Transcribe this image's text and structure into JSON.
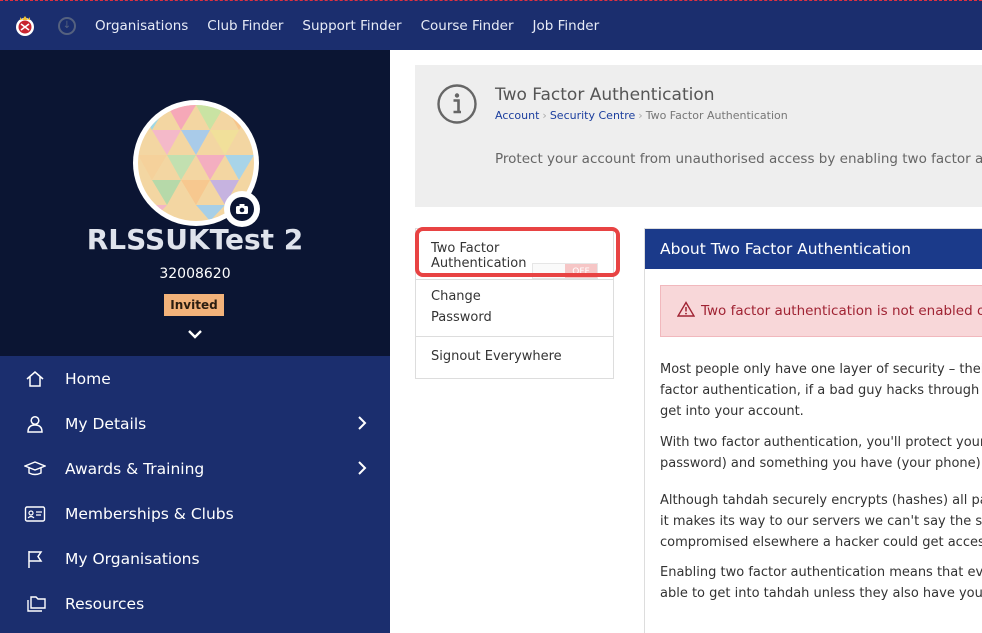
{
  "nav": {
    "links": [
      "Organisations",
      "Club Finder",
      "Support Finder",
      "Course Finder",
      "Job Finder"
    ]
  },
  "profile": {
    "name": "RLSSUKTest 2",
    "member_number": "32008620",
    "status_badge": "Invited"
  },
  "sidebar": {
    "items": [
      {
        "label": "Home",
        "icon": "home-icon",
        "has_arrow": false
      },
      {
        "label": "My Details",
        "icon": "user-icon",
        "has_arrow": true
      },
      {
        "label": "Awards & Training",
        "icon": "graduation-cap-icon",
        "has_arrow": true
      },
      {
        "label": "Memberships & Clubs",
        "icon": "id-card-icon",
        "has_arrow": false
      },
      {
        "label": "My Organisations",
        "icon": "flag-icon",
        "has_arrow": false
      },
      {
        "label": "Resources",
        "icon": "folders-icon",
        "has_arrow": false
      }
    ]
  },
  "header": {
    "title": "Two Factor Authentication",
    "breadcrumb": [
      "Account",
      "Security Centre",
      "Two Factor Authentication"
    ],
    "description": "Protect your account from unauthorised access by enabling two factor authent"
  },
  "tabs": {
    "two_factor": "Two Factor Authentication",
    "toggle_state": "OFF",
    "change_password_line1": "Change",
    "change_password_line2": "Password",
    "signout": "Signout Everywhere"
  },
  "about": {
    "title": "About Two Factor Authentication",
    "alert": "Two factor authentication is not enabled on yo",
    "paragraphs": [
      [
        "Most people only have one layer of security – their pa",
        "factor authentication, if a bad guy hacks through yo",
        "get into your account."
      ],
      [
        "With two factor authentication, you'll protect your a",
        "password) and something you have (your phone)."
      ],
      [
        "Although tahdah securely encrypts (hashes) all pass",
        "it makes its way to our servers we can't say the same",
        "compromised elsewhere a hacker could get access to"
      ],
      [
        "Enabling two factor authentication means that ever",
        "able to get into tahdah unless they also have your ph"
      ]
    ]
  },
  "colors": {
    "nav_bg": "#1b2e6e",
    "sidebar_dark": "#0b1533",
    "accent_blue": "#1b3a8a",
    "highlight_red": "#e84343",
    "badge": "#f2b27a",
    "alert_bg": "#f8d7d9"
  }
}
